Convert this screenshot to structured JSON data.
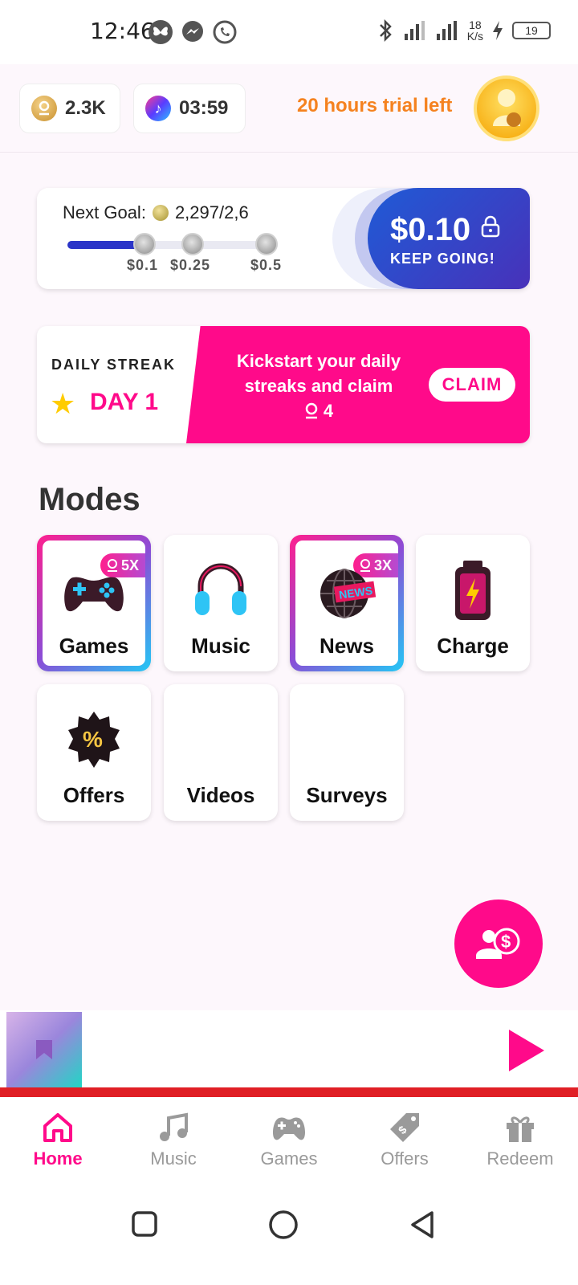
{
  "status_bar": {
    "time": "12:46",
    "network_speed": "18\nK/s",
    "battery": "19"
  },
  "header": {
    "coins": "2.3K",
    "timer": "03:59",
    "trial_text": "20 hours trial left"
  },
  "goal": {
    "label": "Next Goal:",
    "progress_text": "2,297/2,6",
    "progress_fraction": 0.35,
    "milestones": [
      "$0.1",
      "$0.25",
      "$0.5"
    ],
    "reward": "$0.10",
    "reward_sub": "KEEP GOING!"
  },
  "streak": {
    "title": "DAILY STREAK",
    "day": "DAY 1",
    "message_line1": "Kickstart your daily",
    "message_line2": "streaks and claim",
    "reward": "4",
    "claim_label": "CLAIM"
  },
  "modes": {
    "title": "Modes",
    "items": [
      {
        "label": "Games",
        "badge": "5X"
      },
      {
        "label": "Music"
      },
      {
        "label": "News",
        "badge": "3X"
      },
      {
        "label": "Charge"
      },
      {
        "label": "Offers"
      },
      {
        "label": "Videos"
      },
      {
        "label": "Surveys"
      }
    ]
  },
  "bottom_nav": {
    "items": [
      {
        "label": "Home",
        "icon": "home-icon",
        "active": true
      },
      {
        "label": "Music",
        "icon": "music-icon"
      },
      {
        "label": "Games",
        "icon": "gamepad-icon"
      },
      {
        "label": "Offers",
        "icon": "tag-icon"
      },
      {
        "label": "Redeem",
        "icon": "gift-icon"
      }
    ]
  },
  "colors": {
    "accent": "#ff0a8a",
    "trial": "#f5821f",
    "reward_bg": "#2b35c8",
    "progress_bar": "#e01f25"
  }
}
